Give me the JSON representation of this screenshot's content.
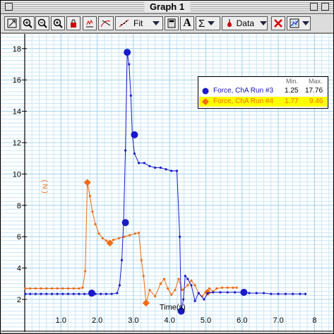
{
  "window": {
    "title": "Graph 1"
  },
  "toolbar": {
    "fit_label": "Fit",
    "data_label": "Data",
    "sigma_label": "Σ",
    "text_tool_label": "A"
  },
  "colors": {
    "series1": "#1a1acc",
    "series2": "#f26a12",
    "legend_highlight": "#ffff00",
    "grid_minor": "#c9e6f7",
    "grid_major": "#a8d4ee"
  },
  "legend": {
    "min_header": "Min.",
    "max_header": "Max.",
    "rows": [
      {
        "name": "Force, ChA Run #3",
        "min": "1.25",
        "max": "17.76"
      },
      {
        "name": "Force, ChA Run #4",
        "min": "1.77",
        "max": "9.46"
      }
    ]
  },
  "chart_data": {
    "type": "line",
    "xlabel": "Time(s)",
    "ylabel": "( N )",
    "xlim": [
      0,
      8
    ],
    "ylim": [
      0.3,
      19
    ],
    "x_ticks": [
      "1.0",
      "2.0",
      "3.0",
      "4.0",
      "5.0",
      "6.0",
      "7.0",
      "8"
    ],
    "y_ticks": [
      "2",
      "4",
      "6",
      "8",
      "10",
      "12",
      "14",
      "16",
      "18"
    ],
    "grid": true,
    "legend_position": "top-right",
    "series": [
      {
        "name": "Force, ChA Run #3",
        "marker": "circle",
        "points": [
          [
            0.02,
            2.35
          ],
          [
            0.15,
            2.35
          ],
          [
            0.3,
            2.35
          ],
          [
            0.45,
            2.35
          ],
          [
            0.6,
            2.35
          ],
          [
            0.75,
            2.35
          ],
          [
            0.9,
            2.35
          ],
          [
            1.05,
            2.35
          ],
          [
            1.2,
            2.35
          ],
          [
            1.35,
            2.35
          ],
          [
            1.5,
            2.35
          ],
          [
            1.65,
            2.35
          ],
          [
            1.8,
            2.35
          ],
          [
            1.95,
            2.35
          ],
          [
            2.1,
            2.35
          ],
          [
            2.25,
            2.35
          ],
          [
            2.4,
            2.35
          ],
          [
            2.55,
            2.4
          ],
          [
            2.62,
            2.9
          ],
          [
            2.68,
            4.5
          ],
          [
            2.73,
            6.9
          ],
          [
            2.78,
            11.5
          ],
          [
            2.83,
            17.76
          ],
          [
            2.88,
            17.0
          ],
          [
            2.93,
            15.0
          ],
          [
            2.97,
            12.5
          ],
          [
            3.03,
            11.3
          ],
          [
            3.15,
            10.7
          ],
          [
            3.3,
            10.7
          ],
          [
            3.45,
            10.5
          ],
          [
            3.6,
            10.4
          ],
          [
            3.75,
            10.4
          ],
          [
            3.9,
            10.3
          ],
          [
            4.05,
            10.2
          ],
          [
            4.2,
            10.2
          ],
          [
            4.28,
            6.0
          ],
          [
            4.32,
            1.25
          ],
          [
            4.38,
            2.0
          ],
          [
            4.43,
            3.5
          ],
          [
            4.5,
            3.3
          ],
          [
            4.6,
            2.9
          ],
          [
            4.7,
            1.9
          ],
          [
            4.8,
            2.4
          ],
          [
            4.95,
            2.0
          ],
          [
            5.05,
            2.4
          ],
          [
            5.2,
            2.45
          ],
          [
            5.4,
            2.45
          ],
          [
            5.6,
            2.45
          ],
          [
            5.8,
            2.45
          ],
          [
            6.0,
            2.45
          ],
          [
            6.2,
            2.4
          ],
          [
            6.4,
            2.4
          ],
          [
            6.6,
            2.4
          ],
          [
            6.8,
            2.35
          ],
          [
            7.0,
            2.35
          ],
          [
            7.2,
            2.35
          ],
          [
            7.4,
            2.35
          ],
          [
            7.6,
            2.35
          ],
          [
            7.75,
            2.35
          ]
        ],
        "big_markers": [
          [
            1.85,
            2.4
          ],
          [
            2.78,
            6.9
          ],
          [
            2.83,
            17.76
          ],
          [
            3.03,
            12.5
          ],
          [
            4.32,
            1.25
          ],
          [
            6.05,
            2.45
          ]
        ]
      },
      {
        "name": "Force, ChA Run #4",
        "marker": "diamond",
        "points": [
          [
            0.02,
            2.7
          ],
          [
            0.15,
            2.7
          ],
          [
            0.3,
            2.7
          ],
          [
            0.45,
            2.7
          ],
          [
            0.6,
            2.7
          ],
          [
            0.75,
            2.7
          ],
          [
            0.9,
            2.7
          ],
          [
            1.05,
            2.7
          ],
          [
            1.2,
            2.7
          ],
          [
            1.35,
            2.7
          ],
          [
            1.5,
            2.7
          ],
          [
            1.6,
            2.75
          ],
          [
            1.67,
            3.8
          ],
          [
            1.73,
            9.46
          ],
          [
            1.8,
            8.6
          ],
          [
            1.87,
            7.6
          ],
          [
            1.95,
            6.8
          ],
          [
            2.05,
            6.2
          ],
          [
            2.15,
            5.9
          ],
          [
            2.25,
            5.75
          ],
          [
            2.35,
            5.6
          ],
          [
            2.45,
            5.8
          ],
          [
            2.6,
            5.9
          ],
          [
            2.75,
            6.0
          ],
          [
            2.9,
            6.1
          ],
          [
            3.05,
            6.2
          ],
          [
            3.15,
            6.25
          ],
          [
            3.22,
            4.5
          ],
          [
            3.28,
            3.5
          ],
          [
            3.35,
            1.77
          ],
          [
            3.45,
            2.6
          ],
          [
            3.6,
            2.2
          ],
          [
            3.75,
            3.0
          ],
          [
            3.85,
            3.3
          ],
          [
            3.95,
            2.7
          ],
          [
            4.05,
            2.3
          ],
          [
            4.15,
            2.6
          ],
          [
            4.25,
            3.3
          ],
          [
            4.35,
            2.6
          ],
          [
            4.5,
            2.9
          ],
          [
            4.6,
            3.2
          ],
          [
            4.7,
            2.9
          ],
          [
            4.8,
            2.4
          ],
          [
            4.9,
            2.2
          ],
          [
            5.0,
            2.5
          ],
          [
            5.1,
            2.7
          ],
          [
            5.2,
            2.5
          ],
          [
            5.3,
            2.7
          ],
          [
            5.45,
            2.75
          ],
          [
            5.6,
            2.75
          ],
          [
            5.75,
            2.75
          ],
          [
            5.85,
            2.75
          ]
        ],
        "big_markers": [
          [
            1.73,
            9.46
          ],
          [
            2.35,
            5.6
          ],
          [
            3.35,
            1.77
          ],
          [
            5.05,
            2.45
          ]
        ]
      }
    ]
  }
}
